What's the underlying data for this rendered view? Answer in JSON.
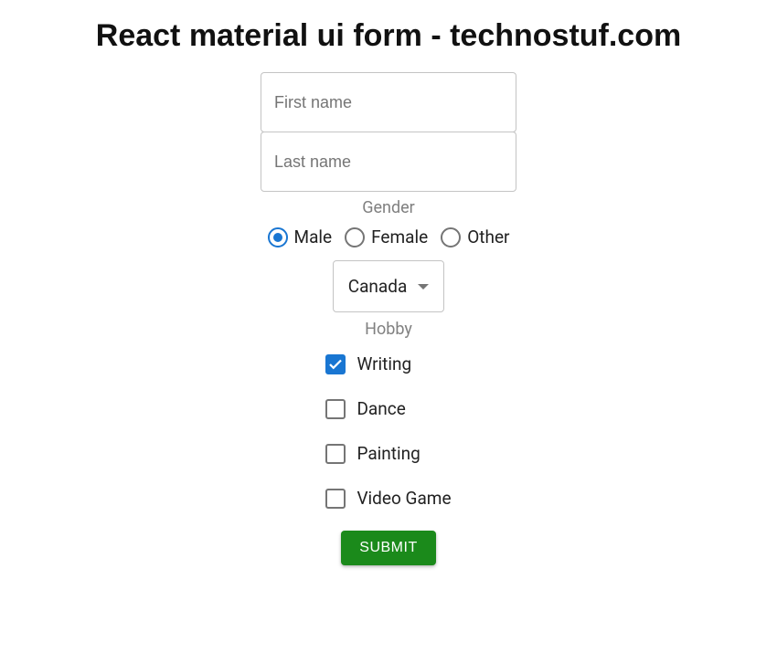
{
  "title": "React material ui form - technostuf.com",
  "form": {
    "first_name": {
      "placeholder": "First name",
      "value": ""
    },
    "last_name": {
      "placeholder": "Last name",
      "value": ""
    },
    "gender": {
      "label": "Gender",
      "options": [
        {
          "label": "Male",
          "selected": true
        },
        {
          "label": "Female",
          "selected": false
        },
        {
          "label": "Other",
          "selected": false
        }
      ]
    },
    "country": {
      "selected": "Canada"
    },
    "hobby": {
      "label": "Hobby",
      "options": [
        {
          "label": "Writing",
          "checked": true
        },
        {
          "label": "Dance",
          "checked": false
        },
        {
          "label": "Painting",
          "checked": false
        },
        {
          "label": "Video Game",
          "checked": false
        }
      ]
    },
    "submit_label": "SUBMIT"
  },
  "colors": {
    "primary": "#1976d2",
    "success": "#1b8a1b",
    "border": "rgba(0,0,0,0.23)",
    "muted": "#757575"
  }
}
